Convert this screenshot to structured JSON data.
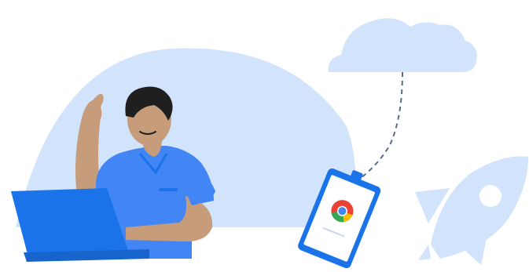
{
  "illustration": {
    "subject": "person-at-laptop-with-chrome-device-cloud-and-rocket",
    "icons": [
      "cloud-icon",
      "chrome-logo-icon",
      "rocket-icon",
      "laptop-icon",
      "person-illustration"
    ],
    "colors": {
      "pale_blue": "#d2e3fc",
      "brand_blue": "#1a73e8",
      "shirt_blue": "#4285f4",
      "skin": "#c69c7a",
      "hair": "#1f1f1f",
      "chrome_red": "#ea4335",
      "chrome_yellow": "#fbbc04",
      "chrome_green": "#34a853",
      "dash_line": "#5a6a8a"
    }
  }
}
